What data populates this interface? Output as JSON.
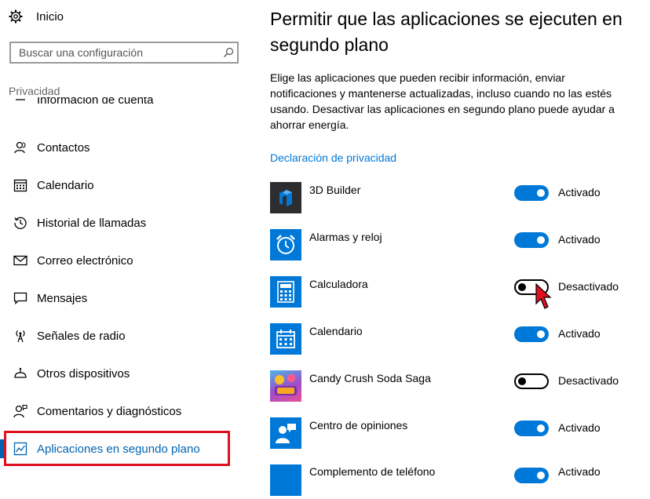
{
  "sidebar": {
    "home_label": "Inicio",
    "search_placeholder": "Buscar una configuración",
    "section_label": "Privacidad",
    "items": [
      {
        "label": "Información de cuenta",
        "icon": "account-card-icon"
      },
      {
        "label": "Contactos",
        "icon": "contacts-icon"
      },
      {
        "label": "Calendario",
        "icon": "calendar-icon"
      },
      {
        "label": "Historial de llamadas",
        "icon": "history-icon"
      },
      {
        "label": "Correo electrónico",
        "icon": "mail-icon"
      },
      {
        "label": "Mensajes",
        "icon": "message-icon"
      },
      {
        "label": "Señales de radio",
        "icon": "radio-antenna-icon"
      },
      {
        "label": "Otros dispositivos",
        "icon": "devices-icon"
      },
      {
        "label": "Comentarios y diagnósticos",
        "icon": "feedback-icon"
      },
      {
        "label": "Aplicaciones en segundo plano",
        "icon": "background-apps-icon",
        "active": true
      }
    ]
  },
  "main": {
    "title": "Permitir que las aplicaciones se ejecuten en segundo plano",
    "description": "Elige las aplicaciones que pueden recibir información, enviar notificaciones y mantenerse actualizadas, incluso cuando no las estés usando. Desactivar las aplicaciones en segundo plano puede ayudar a ahorrar energía.",
    "privacy_link": "Declaración de privacidad",
    "apps": [
      {
        "name": "3D Builder",
        "state": "Activado",
        "on": true,
        "icon": "3d-builder-icon",
        "color": "#2d2d30"
      },
      {
        "name": "Alarmas y reloj",
        "state": "Activado",
        "on": true,
        "icon": "alarm-clock-icon",
        "color": "#0078d7"
      },
      {
        "name": "Calculadora",
        "state": "Desactivado",
        "on": false,
        "icon": "calculator-icon",
        "color": "#0078d7"
      },
      {
        "name": "Calendario",
        "state": "Activado",
        "on": true,
        "icon": "calendar-app-icon",
        "color": "#0078d7"
      },
      {
        "name": "Candy Crush Soda Saga",
        "state": "Desactivado",
        "on": false,
        "icon": "candy-crush-icon",
        "color": "#8e44ad"
      },
      {
        "name": "Centro de opiniones",
        "state": "Activado",
        "on": true,
        "icon": "feedback-hub-icon",
        "color": "#0078d7"
      },
      {
        "name": "Complemento de teléfono",
        "state": "Activado",
        "on": true,
        "icon": "phone-companion-icon",
        "color": "#0078d7"
      }
    ]
  },
  "colors": {
    "accent": "#0078d7",
    "active_nav": "#0063b1",
    "highlight_border": "#e0101e"
  }
}
